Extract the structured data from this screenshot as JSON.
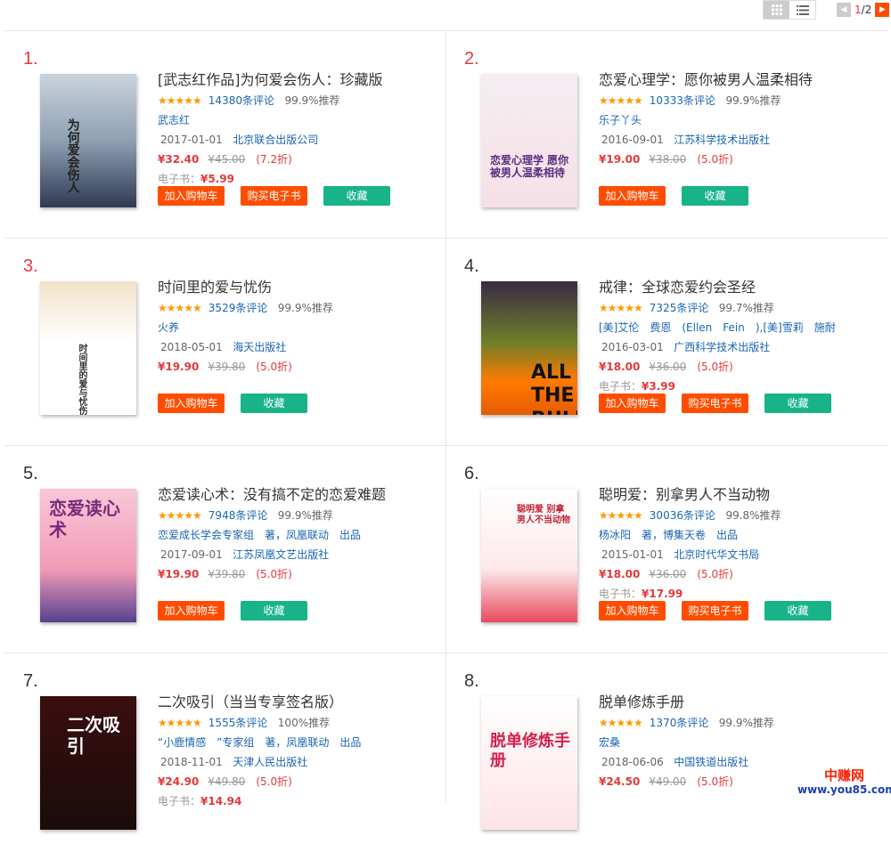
{
  "toolbar": {
    "view_modes": [
      "grid-icon",
      "list-icon"
    ],
    "pager": {
      "current": "1",
      "sep": "/",
      "total": "2"
    }
  },
  "colors": {
    "rank_top": "#e4393c",
    "price": "#e4393c",
    "button_orange": "#ff4d00",
    "button_green": "#19b38a",
    "link": "#1a66b3"
  },
  "books": [
    {
      "rank": "1.",
      "title": "[武志红作品]为何爱会伤人：珍藏版",
      "reviews": "14380条评论",
      "recommend": "99.9%推荐",
      "author_line": "武志红",
      "date": "2017-01-01",
      "publisher": "北京联合出版公司",
      "price": "¥32.40",
      "orig_price": "¥45.00",
      "discount": "(7.2折)",
      "ebook_label": "电子书：",
      "ebook_price": "¥5.99",
      "buttons": [
        "加入购物车",
        "购买电子书",
        "收藏"
      ],
      "cover_text": "为何爱会伤人"
    },
    {
      "rank": "2.",
      "title": "恋爱心理学：愿你被男人温柔相待",
      "reviews": "10333条评论",
      "recommend": "99.9%推荐",
      "author_line": "乐子丫头",
      "date": "2016-09-01",
      "publisher": "江苏科学技术出版社",
      "price": "¥19.00",
      "orig_price": "¥38.00",
      "discount": "(5.0折)",
      "ebook_label": "",
      "ebook_price": "",
      "buttons": [
        "加入购物车",
        "收藏"
      ],
      "cover_text": "恋爱心理学 愿你被男人温柔相待"
    },
    {
      "rank": "3.",
      "title": "时间里的爱与忧伤",
      "reviews": "3529条评论",
      "recommend": "99.9%推荐",
      "author_line": "火养",
      "date": "2018-05-01",
      "publisher": "海天出版社",
      "price": "¥19.90",
      "orig_price": "¥39.80",
      "discount": "(5.0折)",
      "ebook_label": "",
      "ebook_price": "",
      "buttons": [
        "加入购物车",
        "收藏"
      ],
      "cover_text": "时间里的爱与忧伤"
    },
    {
      "rank": "4.",
      "title": "戒律：全球恋爱约会圣经",
      "reviews": "7325条评论",
      "recommend": "99.7%推荐",
      "author_line": "[美]艾伦　费恩　(Ellen　Fein　),[美]雪莉　施耐",
      "date": "2016-03-01",
      "publisher": "广西科学技术出版社",
      "price": "¥18.00",
      "orig_price": "¥36.00",
      "discount": "(5.0折)",
      "ebook_label": "电子书：",
      "ebook_price": "¥3.99",
      "buttons": [
        "加入购物车",
        "购买电子书",
        "收藏"
      ],
      "cover_text": "ALL THE RULES 戒律"
    },
    {
      "rank": "5.",
      "title": "恋爱读心术：没有搞不定的恋爱难题",
      "reviews": "7948条评论",
      "recommend": "99.9%推荐",
      "author_line": "恋爱成长学会专家组　著，凤凰联动　出品",
      "date": "2017-09-01",
      "publisher": "江苏凤凰文艺出版社",
      "price": "¥19.90",
      "orig_price": "¥39.80",
      "discount": "(5.0折)",
      "ebook_label": "",
      "ebook_price": "",
      "buttons": [
        "加入购物车",
        "收藏"
      ],
      "cover_text": "恋爱读心术"
    },
    {
      "rank": "6.",
      "title": "聪明爱：别拿男人不当动物",
      "reviews": "30036条评论",
      "recommend": "99.8%推荐",
      "author_line": "杨冰阳　著，博集天卷　出品",
      "date": "2015-01-01",
      "publisher": "北京时代华文书局",
      "price": "¥18.00",
      "orig_price": "¥36.00",
      "discount": "(5.0折)",
      "ebook_label": "电子书：",
      "ebook_price": "¥17.99",
      "buttons": [
        "加入购物车",
        "购买电子书",
        "收藏"
      ],
      "cover_text": "聪明爱 别拿男人不当动物"
    },
    {
      "rank": "7.",
      "title": "二次吸引（当当专享签名版）",
      "reviews": "1555条评论",
      "recommend": "100%推荐",
      "author_line": "“小鹿情感　”专家组　著，凤凰联动　出品",
      "date": "2018-11-01",
      "publisher": "天津人民出版社",
      "price": "¥24.90",
      "orig_price": "¥49.80",
      "discount": "(5.0折)",
      "ebook_label": "电子书：",
      "ebook_price": "¥14.94",
      "buttons": [],
      "cover_text": "二次吸引"
    },
    {
      "rank": "8.",
      "title": "脱单修炼手册",
      "reviews": "1370条评论",
      "recommend": "99.9%推荐",
      "author_line": "宏桑",
      "date": "2018-06-06",
      "publisher": "中国铁道出版社",
      "price": "¥24.50",
      "orig_price": "¥49.00",
      "discount": "(5.0折)",
      "ebook_label": "",
      "ebook_price": "",
      "buttons": [],
      "cover_text": "脱单修炼手册"
    }
  ],
  "watermark": {
    "top": "中赚网",
    "bottom": "www.you85.com"
  }
}
